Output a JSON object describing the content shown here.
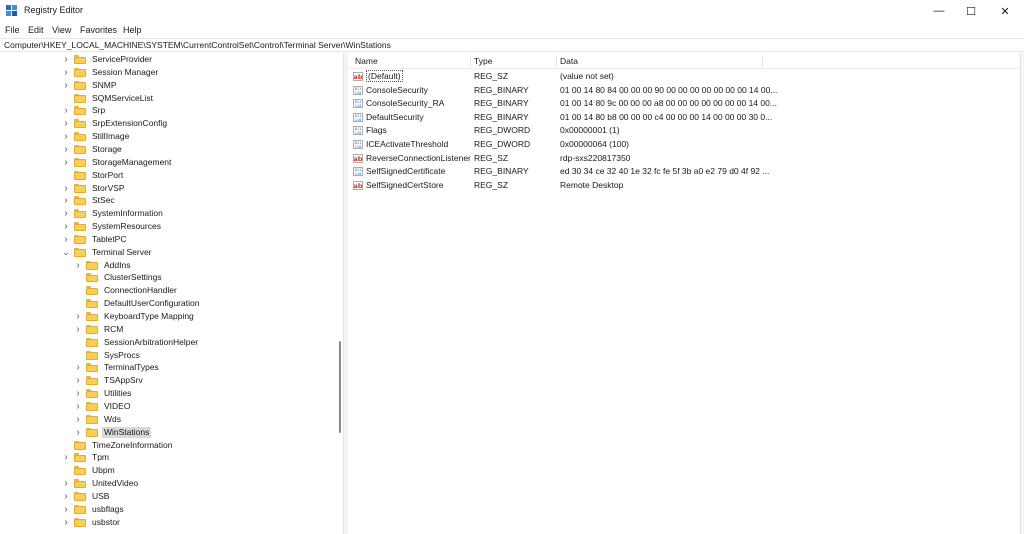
{
  "window": {
    "title": "Registry Editor",
    "controls": {
      "minimize": "—",
      "maximize": "☐",
      "close": "✕"
    }
  },
  "menu": [
    "File",
    "Edit",
    "View",
    "Favorites",
    "Help"
  ],
  "address": "Computer\\HKEY_LOCAL_MACHINE\\SYSTEM\\CurrentControlSet\\Control\\Terminal Server\\WinStations",
  "tree": [
    {
      "label": "ServiceProvider",
      "level": 0,
      "chevron": "right"
    },
    {
      "label": "Session Manager",
      "level": 0,
      "chevron": "right"
    },
    {
      "label": "SNMP",
      "level": 0,
      "chevron": "right"
    },
    {
      "label": "SQMServiceList",
      "level": 0,
      "chevron": "none"
    },
    {
      "label": "Srp",
      "level": 0,
      "chevron": "right"
    },
    {
      "label": "SrpExtensionConfig",
      "level": 0,
      "chevron": "right"
    },
    {
      "label": "StillImage",
      "level": 0,
      "chevron": "right"
    },
    {
      "label": "Storage",
      "level": 0,
      "chevron": "right"
    },
    {
      "label": "StorageManagement",
      "level": 0,
      "chevron": "right"
    },
    {
      "label": "StorPort",
      "level": 0,
      "chevron": "none"
    },
    {
      "label": "StorVSP",
      "level": 0,
      "chevron": "right"
    },
    {
      "label": "StSec",
      "level": 0,
      "chevron": "right"
    },
    {
      "label": "SystemInformation",
      "level": 0,
      "chevron": "right"
    },
    {
      "label": "SystemResources",
      "level": 0,
      "chevron": "right"
    },
    {
      "label": "TabletPC",
      "level": 0,
      "chevron": "right"
    },
    {
      "label": "Terminal Server",
      "level": 0,
      "chevron": "down"
    },
    {
      "label": "AddIns",
      "level": 1,
      "chevron": "right"
    },
    {
      "label": "ClusterSettings",
      "level": 1,
      "chevron": "none"
    },
    {
      "label": "ConnectionHandler",
      "level": 1,
      "chevron": "none"
    },
    {
      "label": "DefaultUserConfiguration",
      "level": 1,
      "chevron": "none"
    },
    {
      "label": "KeyboardType Mapping",
      "level": 1,
      "chevron": "right"
    },
    {
      "label": "RCM",
      "level": 1,
      "chevron": "right"
    },
    {
      "label": "SessionArbitrationHelper",
      "level": 1,
      "chevron": "none"
    },
    {
      "label": "SysProcs",
      "level": 1,
      "chevron": "none"
    },
    {
      "label": "TerminalTypes",
      "level": 1,
      "chevron": "right"
    },
    {
      "label": "TSAppSrv",
      "level": 1,
      "chevron": "right"
    },
    {
      "label": "Utilities",
      "level": 1,
      "chevron": "right"
    },
    {
      "label": "VIDEO",
      "level": 1,
      "chevron": "right"
    },
    {
      "label": "Wds",
      "level": 1,
      "chevron": "right"
    },
    {
      "label": "WinStations",
      "level": 1,
      "chevron": "right",
      "selected": true
    },
    {
      "label": "TimeZoneInformation",
      "level": 0,
      "chevron": "none"
    },
    {
      "label": "Tpm",
      "level": 0,
      "chevron": "right"
    },
    {
      "label": "Ubpm",
      "level": 0,
      "chevron": "none"
    },
    {
      "label": "UnitedVideo",
      "level": 0,
      "chevron": "right"
    },
    {
      "label": "USB",
      "level": 0,
      "chevron": "right"
    },
    {
      "label": "usbflags",
      "level": 0,
      "chevron": "right"
    },
    {
      "label": "usbstor",
      "level": 0,
      "chevron": "right"
    }
  ],
  "list": {
    "headers": [
      "Name",
      "Type",
      "Data"
    ],
    "rows": [
      {
        "name": "(Default)",
        "type": "REG_SZ",
        "data": "(value not set)",
        "icon": "string-value-icon"
      },
      {
        "name": "ConsoleSecurity",
        "type": "REG_BINARY",
        "data": "01 00 14 80 84 00 00 00 90 00 00 00 00 00 00 00 14 00...",
        "icon": "binary-value-icon"
      },
      {
        "name": "ConsoleSecurity_RA",
        "type": "REG_BINARY",
        "data": "01 00 14 80 9c 00 00 00 a8 00 00 00 00 00 00 00 14 00...",
        "icon": "binary-value-icon"
      },
      {
        "name": "DefaultSecurity",
        "type": "REG_BINARY",
        "data": "01 00 14 80 b8 00 00 00 c4 00 00 00 14 00 00 00 30 0...",
        "icon": "binary-value-icon"
      },
      {
        "name": "Flags",
        "type": "REG_DWORD",
        "data": "0x00000001 (1)",
        "icon": "binary-value-icon"
      },
      {
        "name": "ICEActivateThreshold",
        "type": "REG_DWORD",
        "data": "0x00000064 (100)",
        "icon": "binary-value-icon"
      },
      {
        "name": "ReverseConnectionListener",
        "type": "REG_SZ",
        "data": "rdp-sxs220817350",
        "icon": "string-value-icon"
      },
      {
        "name": "SelfSignedCertificate",
        "type": "REG_BINARY",
        "data": "ed 30 34 ce 32 40 1e 32 fc fe 5f 3b a0 e2 79 d0 4f 92 ...",
        "icon": "binary-value-icon"
      },
      {
        "name": "SelfSignedCertStore",
        "type": "REG_SZ",
        "data": "Remote Desktop",
        "icon": "string-value-icon"
      }
    ]
  },
  "colors": {
    "folder": "#f8cf5b",
    "folder_border": "#e0ad33",
    "selection": "#d9d9d9",
    "string_icon": "#c0392b",
    "binary_icon": "#2b6cb0"
  }
}
